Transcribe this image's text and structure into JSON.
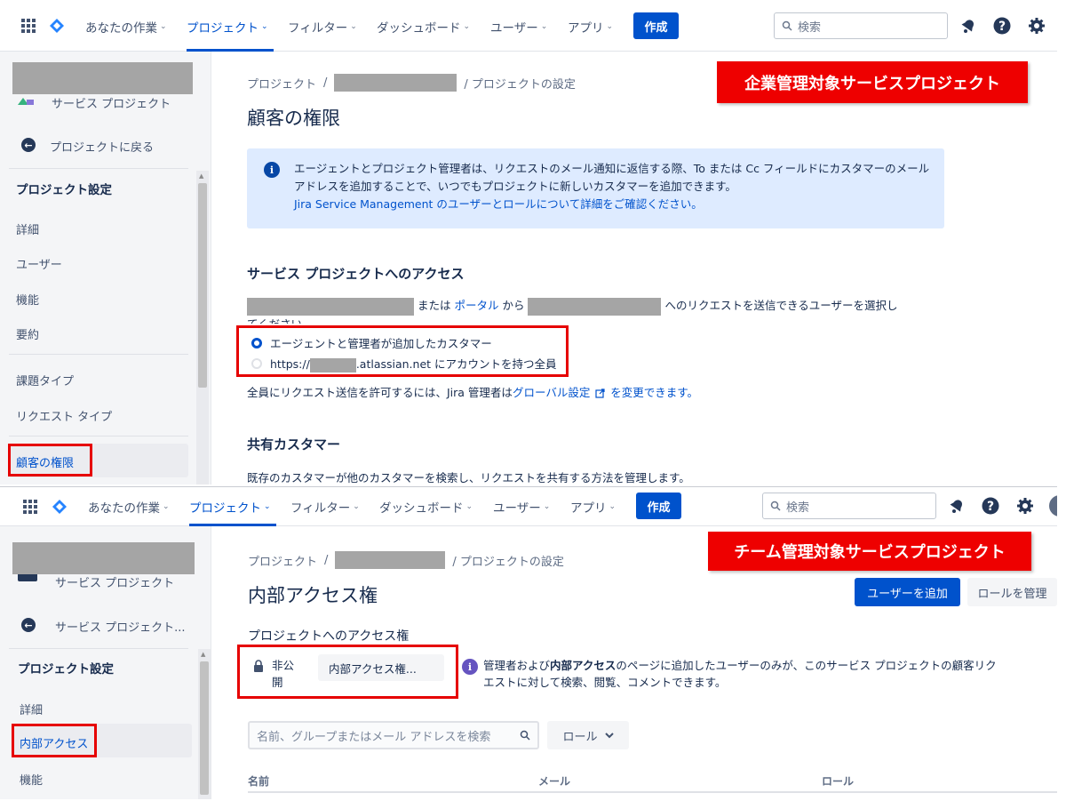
{
  "panel1": {
    "nav": {
      "items": [
        {
          "label": "あなたの作業"
        },
        {
          "label": "プロジェクト"
        },
        {
          "label": "フィルター"
        },
        {
          "label": "ダッシュボード"
        },
        {
          "label": "ユーザー"
        },
        {
          "label": "アプリ"
        }
      ],
      "create_label": "作成",
      "search_placeholder": "検索"
    },
    "sidebar": {
      "project_type": "サービス プロジェクト",
      "back_label": "プロジェクトに戻る",
      "settings_heading": "プロジェクト設定",
      "items": [
        "詳細",
        "ユーザー",
        "機能",
        "要約",
        "課題タイプ",
        "リクエスト タイプ"
      ],
      "active_item": "顧客の権限"
    },
    "breadcrumb": {
      "root": "プロジェクト",
      "sep": "/",
      "leaf": "/ プロジェクトの設定"
    },
    "title": "顧客の権限",
    "red_label": "企業管理対象サービスプロジェクト",
    "info": {
      "text": "エージェントとプロジェクト管理者は、リクエストのメール通知に返信する際、To または Cc フィールドにカスタマーのメールアドレスを追加することで、いつでもプロジェクトに新しいカスタマーを追加できます。",
      "link": "Jira Service Management のユーザーとロールについて詳細をご確認ください。"
    },
    "access": {
      "heading": "サービス プロジェクトへのアクセス",
      "text_or": "または",
      "portal_link": "ポータル",
      "text_from": "から",
      "text_tail": "へのリクエストを送信できるユーザーを選択し",
      "text_tail2": "てください。",
      "option1": "エージェントと管理者が追加したカスタマー",
      "option2_prefix": "https://",
      "option2_suffix": ".atlassian.net にアカウントを持つ全員",
      "note_prefix": "全員にリクエスト送信を許可するには、Jira 管理者は",
      "note_link": "グローバル設定",
      "note_link2": "を変更できます。"
    },
    "shared": {
      "heading": "共有カスタマー",
      "text": "既存のカスタマーが他のカスタマーを検索し、リクエストを共有する方法を管理します。"
    }
  },
  "panel2": {
    "nav": {
      "items": [
        {
          "label": "あなたの作業"
        },
        {
          "label": "プロジェクト"
        },
        {
          "label": "フィルター"
        },
        {
          "label": "ダッシュボード"
        },
        {
          "label": "ユーザー"
        },
        {
          "label": "アプリ"
        }
      ],
      "create_label": "作成",
      "search_placeholder": "検索"
    },
    "sidebar": {
      "project_type": "サービス プロジェクト",
      "back_label": "サービス プロジェクト...",
      "settings_heading": "プロジェクト設定",
      "items": [
        "詳細",
        "機能"
      ],
      "active_item": "内部アクセス"
    },
    "breadcrumb": {
      "root": "プロジェクト",
      "sep": "/",
      "leaf": "/ プロジェクトの設定"
    },
    "title": "内部アクセス権",
    "red_label": "チーム管理対象サービスプロジェクト",
    "add_user_label": "ユーザーを追加",
    "manage_roles_label": "ロールを管理",
    "access_heading": "プロジェクトへのアクセス権",
    "private_label_1": "非公",
    "private_label_2": "開",
    "access_select": "内部アクセス権...",
    "info_prefix": "管理者および",
    "info_bold": "内部アクセス",
    "info_rest": "のページに追加したユーザーのみが、このサービス プロジェクトの顧客リク",
    "info_line2": "エストに対して検索、閲覧、コメントできます。",
    "search_placeholder": "名前、グループまたはメール アドレスを検索",
    "role_filter": "ロール",
    "table_headers": [
      "名前",
      "メール",
      "ロール"
    ]
  },
  "colors": {
    "accent": "#0052cc",
    "red_label": "#ee0000",
    "info_bg": "#deebff"
  }
}
